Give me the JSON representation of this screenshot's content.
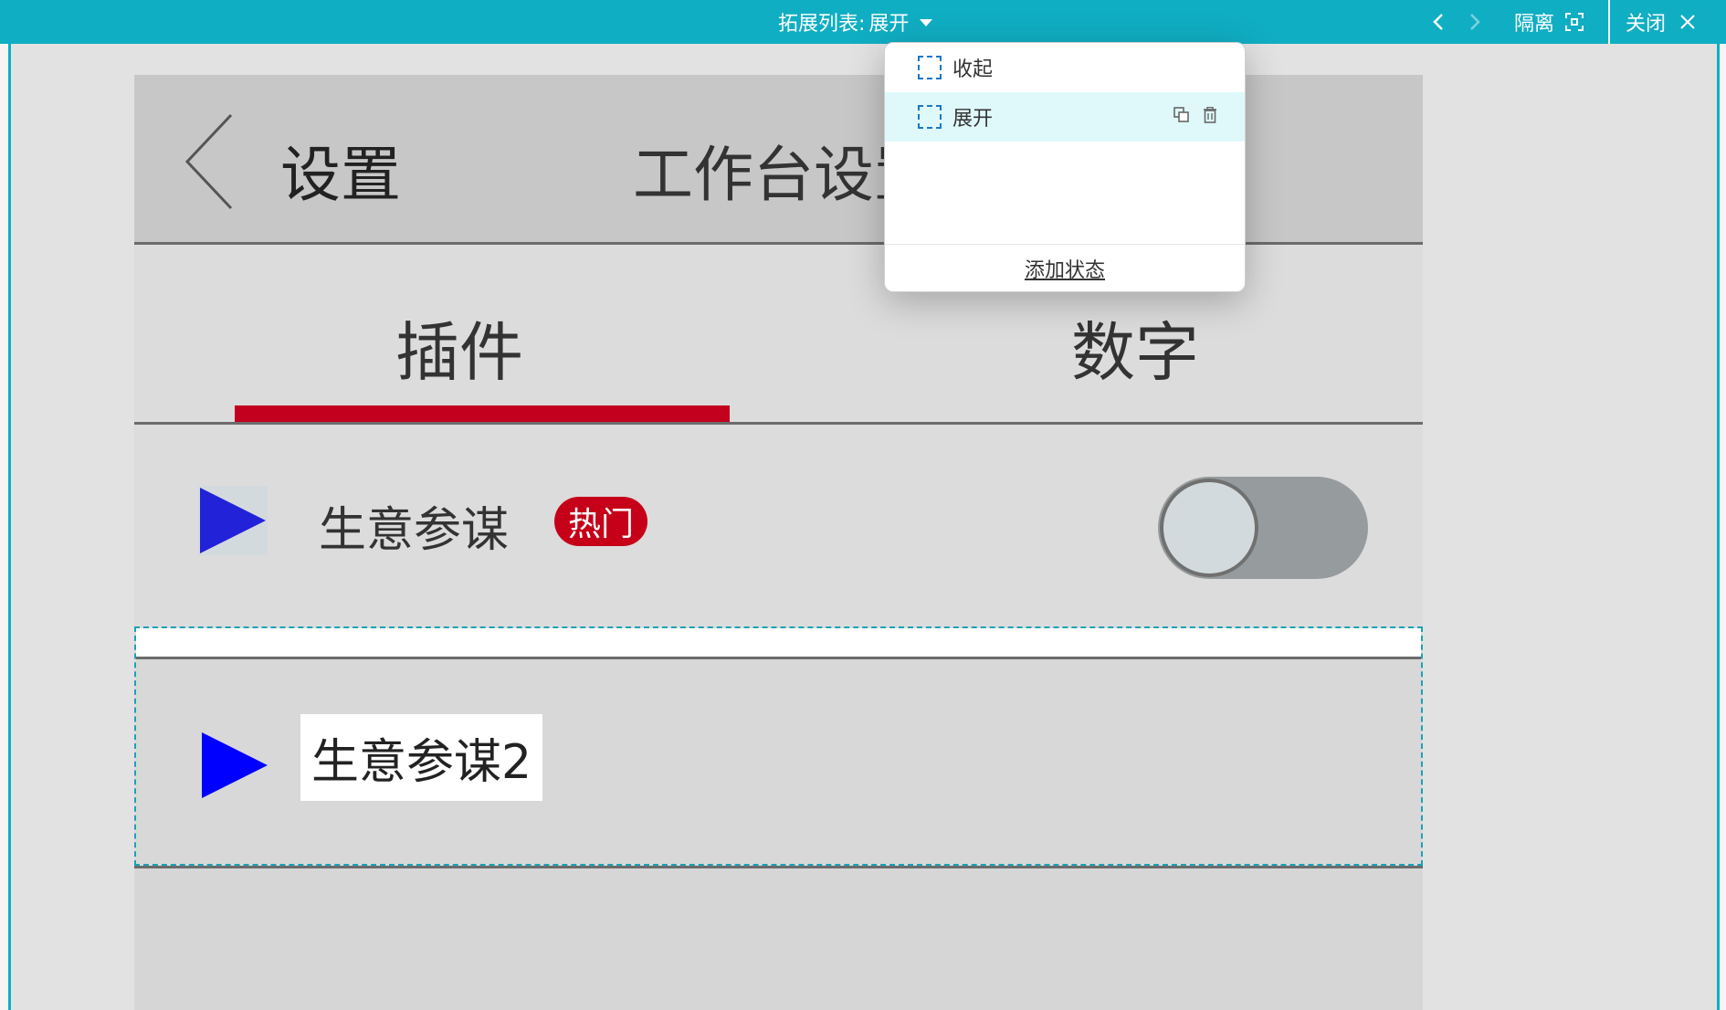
{
  "topbar": {
    "title_prefix": "拓展列表:",
    "title_value": "展开",
    "isolate_label": "隔离",
    "close_label": "关闭"
  },
  "mock": {
    "header_title": "设置",
    "header_subtitle": "工作台设置",
    "tabs": [
      {
        "label": "插件"
      },
      {
        "label": "数字"
      }
    ],
    "row1": {
      "label": "生意参谋",
      "badge": "热门"
    },
    "row2": {
      "label": "生意参谋2"
    }
  },
  "dropdown": {
    "items": [
      {
        "label": "收起"
      },
      {
        "label": "展开"
      }
    ],
    "add_state_label": "添加状态"
  },
  "colors": {
    "accent": "#10aec3",
    "tab_underline": "#c4001f",
    "badge": "#c60018",
    "play_icon_1": "#2222d9",
    "play_icon_2": "#0000ff"
  },
  "icons": [
    "chevron-left-icon",
    "chevron-right-icon",
    "caret-down-icon",
    "isolate-icon",
    "close-icon",
    "back-arrow-icon",
    "play-icon",
    "duplicate-icon",
    "trash-icon",
    "state-box-icon"
  ]
}
